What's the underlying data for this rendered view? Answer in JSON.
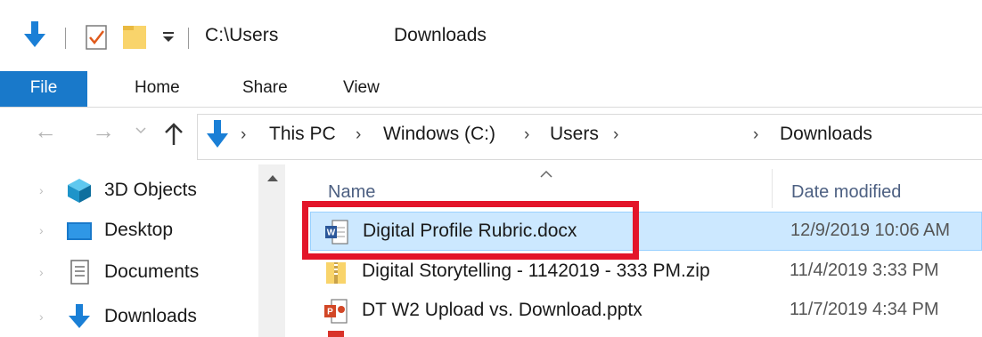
{
  "titlebar": {
    "path": "C:\\Users",
    "folder_name": "Downloads",
    "icons": {
      "download": "download-arrow-icon",
      "properties": "properties-check-icon",
      "folder": "new-folder-icon",
      "dropdown": "qat-dropdown-icon"
    }
  },
  "ribbon": {
    "tabs": [
      {
        "label": "File"
      },
      {
        "label": "Home"
      },
      {
        "label": "Share"
      },
      {
        "label": "View"
      }
    ],
    "accent": "#1979ca"
  },
  "address": {
    "crumbs": [
      "This PC",
      "Windows (C:)",
      "Users",
      "Downloads"
    ],
    "separator": "›"
  },
  "navpane": {
    "items": [
      {
        "label": "3D Objects",
        "icon": "3d-objects-icon"
      },
      {
        "label": "Desktop",
        "icon": "desktop-icon"
      },
      {
        "label": "Documents",
        "icon": "documents-icon"
      },
      {
        "label": "Downloads",
        "icon": "downloads-icon"
      }
    ]
  },
  "filelist": {
    "columns": {
      "name": "Name",
      "date": "Date modified"
    },
    "rows": [
      {
        "name": "Digital Profile Rubric.docx",
        "date": "12/9/2019 10:06 AM",
        "type": "word",
        "selected": true
      },
      {
        "name": "Digital Storytelling - 1142019 - 333 PM.zip",
        "date": "11/4/2019 3:33 PM",
        "type": "zip"
      },
      {
        "name": "DT W2 Upload vs. Download.pptx",
        "date": "11/7/2019 4:34 PM",
        "type": "powerpoint"
      }
    ],
    "highlight_color": "#e3152a",
    "selection_color": "#cce8ff"
  }
}
